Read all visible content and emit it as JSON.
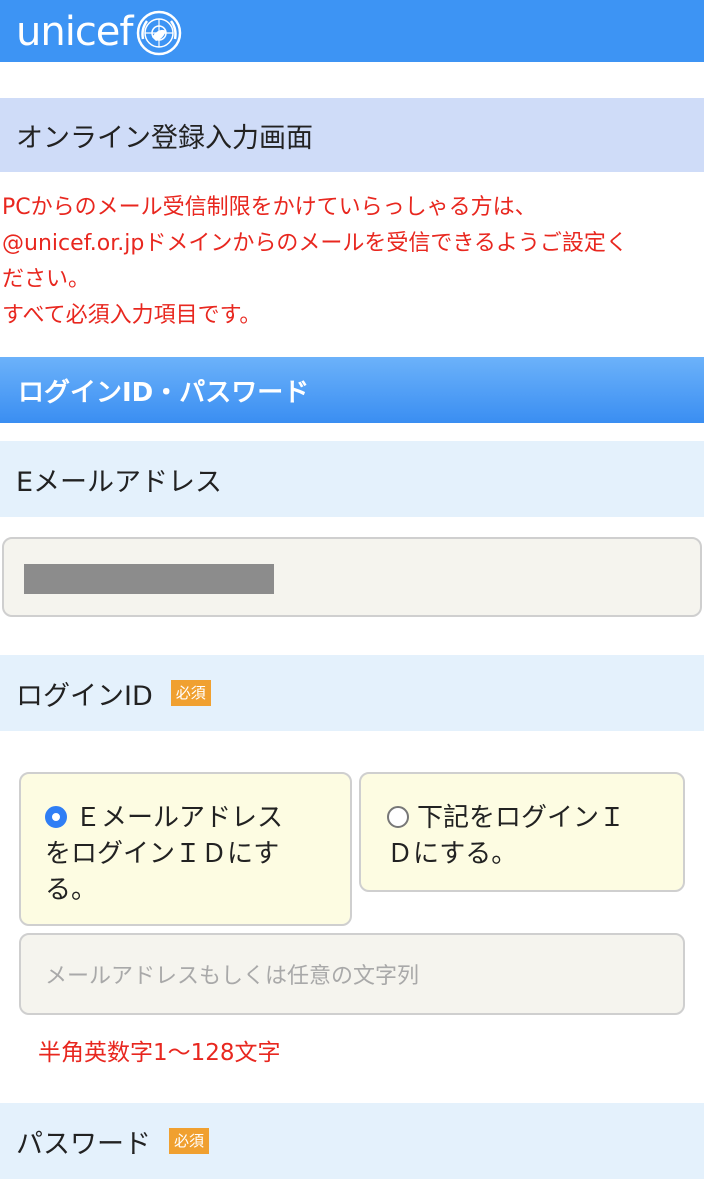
{
  "header": {
    "logo_text": "unicef",
    "logo_icon": "un-emblem-icon",
    "background_color": "#3d94f4"
  },
  "page_title": "オンライン登録入力画面",
  "notice": {
    "lines": [
      "PCからのメール受信制限をかけていらっしゃる方は、",
      "@unicef.or.jpドメインからのメールを受信できるようご設定く",
      "ださい。",
      "すべて必須入力項目です。"
    ],
    "color": "#e8271f"
  },
  "section": {
    "title": "ログインID・パスワード"
  },
  "email": {
    "label": "Eメールアドレス",
    "value": "",
    "value_redacted": true
  },
  "login_id": {
    "label": "ログインID",
    "required_badge": "必須",
    "options": [
      {
        "lines": [
          "Ｅメールアドレス",
          "をログインＩＤにす",
          "る。"
        ],
        "selected": true
      },
      {
        "lines": [
          "下記をログインＩ",
          "Ｄにする。"
        ],
        "selected": false
      }
    ],
    "input_placeholder": "メールアドレスもしくは任意の文字列",
    "hint": "半角英数字1〜128文字"
  },
  "password": {
    "label": "パスワード",
    "required_badge": "必須"
  }
}
